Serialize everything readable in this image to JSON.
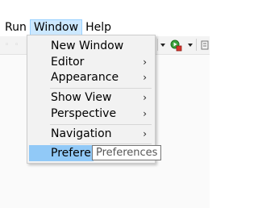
{
  "menubar": {
    "items": [
      {
        "label": "Run"
      },
      {
        "label": "Window"
      },
      {
        "label": "Help"
      }
    ]
  },
  "window_menu": {
    "items": [
      {
        "label": "New Window",
        "submenu": false
      },
      {
        "label": "Editor",
        "submenu": true
      },
      {
        "label": "Appearance",
        "submenu": true
      },
      {
        "label": "Show View",
        "submenu": true
      },
      {
        "label": "Perspective",
        "submenu": true
      },
      {
        "label": "Navigation",
        "submenu": true
      },
      {
        "label": "Preferen",
        "submenu": false,
        "highlighted": true
      }
    ],
    "chevron": "›"
  },
  "tooltip": {
    "text": "Preferences"
  },
  "colors": {
    "menu_active_bg": "#cce8ff",
    "item_highlight_bg": "#91c9f7",
    "menu_bg": "#f2f2f2"
  },
  "toolbar": {
    "icons": [
      "faint-toolbar-icon",
      "run-dropdown-arrow",
      "green-run-icon",
      "run-config-dropdown-arrow"
    ]
  }
}
